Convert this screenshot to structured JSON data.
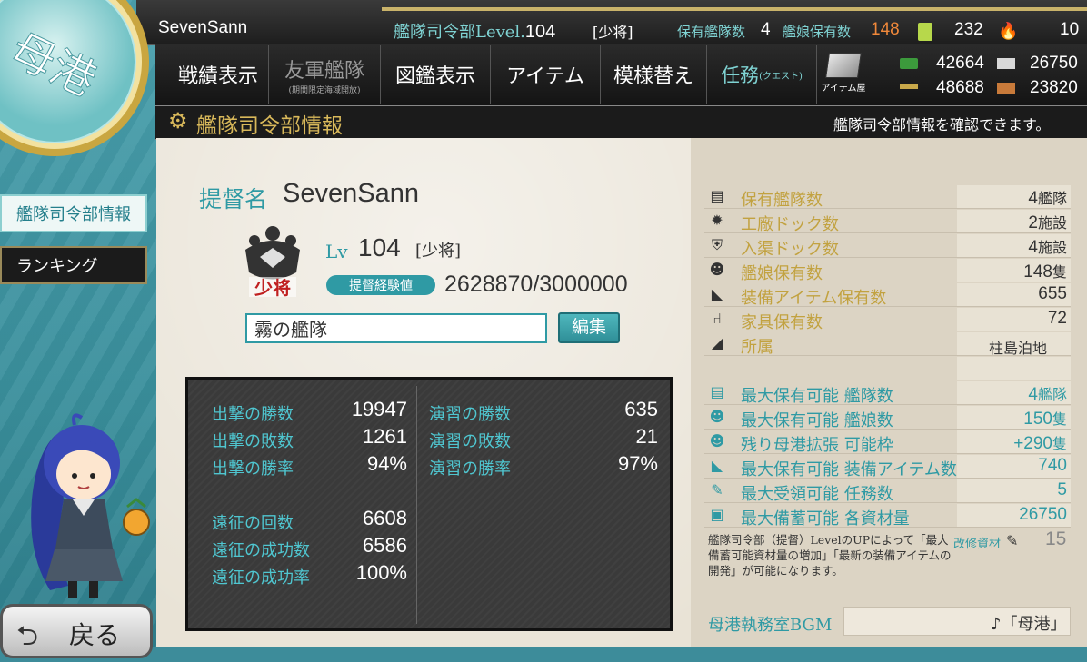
{
  "header": {
    "player_name": "SevenSann",
    "hq_level_label": "艦隊司令部Level.",
    "hq_level": "104",
    "rank": "[少将]",
    "fleet_label": "保有艦隊数",
    "fleet_count": "4",
    "shipgirl_label": "艦娘保有数",
    "shipgirl_count": "148",
    "buckets": "232",
    "dev_materials": "10"
  },
  "nav": {
    "items": [
      {
        "label": "戦績表示"
      },
      {
        "label": "友軍艦隊",
        "sub": "(期間限定海域開放)"
      },
      {
        "label": "図鑑表示"
      },
      {
        "label": "アイテム"
      },
      {
        "label": "模様替え"
      },
      {
        "label": "任務",
        "sub": "(クエスト)"
      }
    ],
    "item_shop_label": "アイテム屋"
  },
  "resources": {
    "fuel": "42664",
    "ammo": "48688",
    "steel": "26750",
    "bauxite": "23820"
  },
  "page": {
    "emblem_text": "母港",
    "title": "艦隊司令部情報",
    "description": "艦隊司令部情報を確認できます。"
  },
  "sidebar": {
    "items": [
      {
        "label": "艦隊司令部情報"
      },
      {
        "label": "ランキング"
      }
    ],
    "back_label": "戻る"
  },
  "admiral": {
    "name_label": "提督名",
    "name": "SevenSann",
    "lv_label": "Lv",
    "level": "104",
    "rank": "[少将]",
    "rank_emblem_text": "少将",
    "exp_label": "提督経験値",
    "exp": "2628870/3000000",
    "comment": "霧の艦隊",
    "edit_label": "編集"
  },
  "stats": {
    "sortie_wins_label": "出撃の勝数",
    "sortie_wins": "19947",
    "sortie_losses_label": "出撃の敗数",
    "sortie_losses": "1261",
    "sortie_rate_label": "出撃の勝率",
    "sortie_rate": "94%",
    "exercise_wins_label": "演習の勝数",
    "exercise_wins": "635",
    "exercise_losses_label": "演習の敗数",
    "exercise_losses": "21",
    "exercise_rate_label": "演習の勝率",
    "exercise_rate": "97%",
    "expedition_count_label": "遠征の回数",
    "expedition_count": "6608",
    "expedition_success_label": "遠征の成功数",
    "expedition_success": "6586",
    "expedition_rate_label": "遠征の成功率",
    "expedition_rate": "100%"
  },
  "info": {
    "rows": [
      {
        "icon": "fleet-icon",
        "label": "保有艦隊数",
        "value": "4",
        "unit": "艦隊"
      },
      {
        "icon": "gear-icon",
        "label": "工廠ドック数",
        "value": "2",
        "unit": "施設"
      },
      {
        "icon": "repair-dock-icon",
        "label": "入渠ドック数",
        "value": "4",
        "unit": "施設"
      },
      {
        "icon": "shipgirl-icon",
        "label": "艦娘保有数",
        "value": "148",
        "unit": "隻"
      },
      {
        "icon": "equipment-icon",
        "label": "装備アイテム保有数",
        "value": "655",
        "unit": ""
      },
      {
        "icon": "furniture-icon",
        "label": "家具保有数",
        "value": "72",
        "unit": ""
      },
      {
        "icon": "base-icon",
        "label": "所属",
        "value": "柱島泊地",
        "unit": ""
      }
    ],
    "max_rows": [
      {
        "icon": "fleet-icon",
        "label": "最大保有可能 艦隊数",
        "value": "4",
        "unit": "艦隊"
      },
      {
        "icon": "shipgirl-icon",
        "label": "最大保有可能 艦娘数",
        "value": "150",
        "unit": "隻"
      },
      {
        "icon": "expand-icon",
        "label": "残り母港拡張 可能枠",
        "value": "+290",
        "unit": "隻"
      },
      {
        "icon": "equipment-icon",
        "label": "最大保有可能 装備アイテム数",
        "value": "740",
        "unit": ""
      },
      {
        "icon": "quest-icon",
        "label": "最大受領可能 任務数",
        "value": "5",
        "unit": ""
      },
      {
        "icon": "storage-icon",
        "label": "最大備蓄可能 各資材量",
        "value": "26750",
        "unit": ""
      }
    ],
    "note": "艦隊司令部（提督）LevelのUPによって「最大備蓄可能資材量の増加」「最新の装備アイテムの開発」が可能になります。",
    "kaishu_label": "改修資材",
    "kaishu_value": "15",
    "bgm_label": "母港執務室BGM",
    "bgm_value": "♪「母港」"
  },
  "colors": {
    "accent_teal": "#2f9aa4",
    "gold": "#c2a240",
    "panel": "#e9e3d6",
    "orange": "#f0883a"
  }
}
